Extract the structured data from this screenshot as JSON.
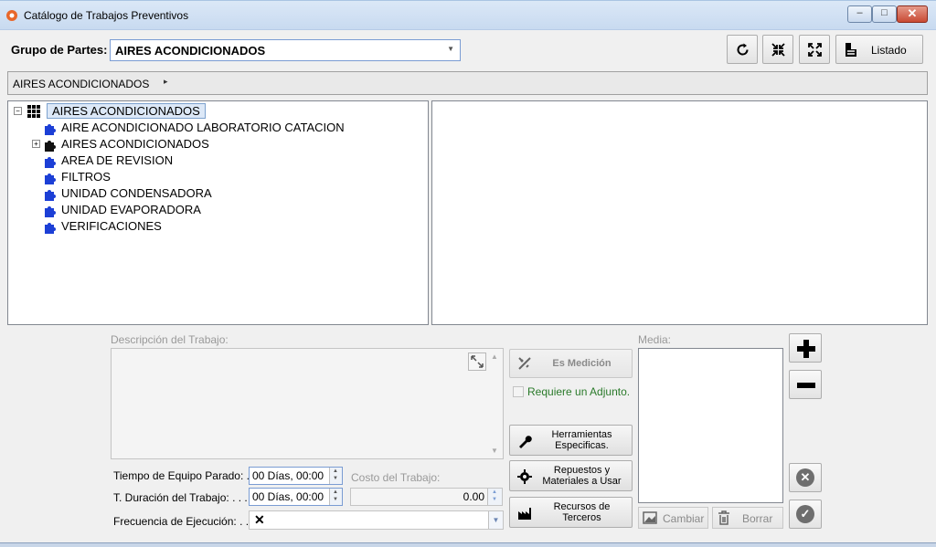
{
  "window": {
    "title": "Catálogo de Trabajos Preventivos",
    "controls": {
      "minimize": "–",
      "maximize": "□",
      "close": "✕"
    }
  },
  "toolbar": {
    "grupo_label": "Grupo de Partes:",
    "grupo_value": "AIRES ACONDICIONADOS",
    "listado_label": "Listado"
  },
  "breadcrumb": {
    "item": "AIRES ACONDICIONADOS"
  },
  "tree": {
    "root": "AIRES ACONDICIONADOS",
    "children": [
      {
        "label": "AIRE ACONDICIONADO LABORATORIO CATACION",
        "expandable": false,
        "icon": "puzzle-blue"
      },
      {
        "label": "AIRES ACONDICIONADOS",
        "expandable": true,
        "icon": "puzzle-black"
      },
      {
        "label": "AREA DE REVISION",
        "expandable": false,
        "icon": "puzzle-blue"
      },
      {
        "label": "FILTROS",
        "expandable": false,
        "icon": "puzzle-blue"
      },
      {
        "label": "UNIDAD CONDENSADORA",
        "expandable": false,
        "icon": "puzzle-blue"
      },
      {
        "label": "UNIDAD EVAPORADORA",
        "expandable": false,
        "icon": "puzzle-blue"
      },
      {
        "label": "VERIFICACIONES",
        "expandable": false,
        "icon": "puzzle-blue"
      }
    ]
  },
  "form": {
    "descripcion_label": "Descripción del Trabajo:",
    "tiempo_parado_label": "Tiempo de Equipo Parado: .",
    "tiempo_parado_value": "00 Días, 00:00",
    "duracion_label": "T. Duración del Trabajo: . . .",
    "duracion_value": "00 Días, 00:00",
    "costo_label": "Costo del Trabajo:",
    "costo_value": "0.00",
    "frecuencia_label": "Frecuencia de Ejecución: . . .",
    "frecuencia_value": "✕"
  },
  "actions": {
    "es_medicion": "Es Medición",
    "requiere_adjunto": "Requiere un Adjunto.",
    "herramientas": "Herramientas Especificas.",
    "repuestos": "Repuestos y Materiales a Usar",
    "recursos": "Recursos de Terceros"
  },
  "media": {
    "label": "Media:",
    "cambiar": "Cambiar",
    "borrar": "Borrar"
  },
  "colors": {
    "accent_blue": "#1c3fd6",
    "node_black": "#111111",
    "check_green": "#2a7a2a"
  }
}
